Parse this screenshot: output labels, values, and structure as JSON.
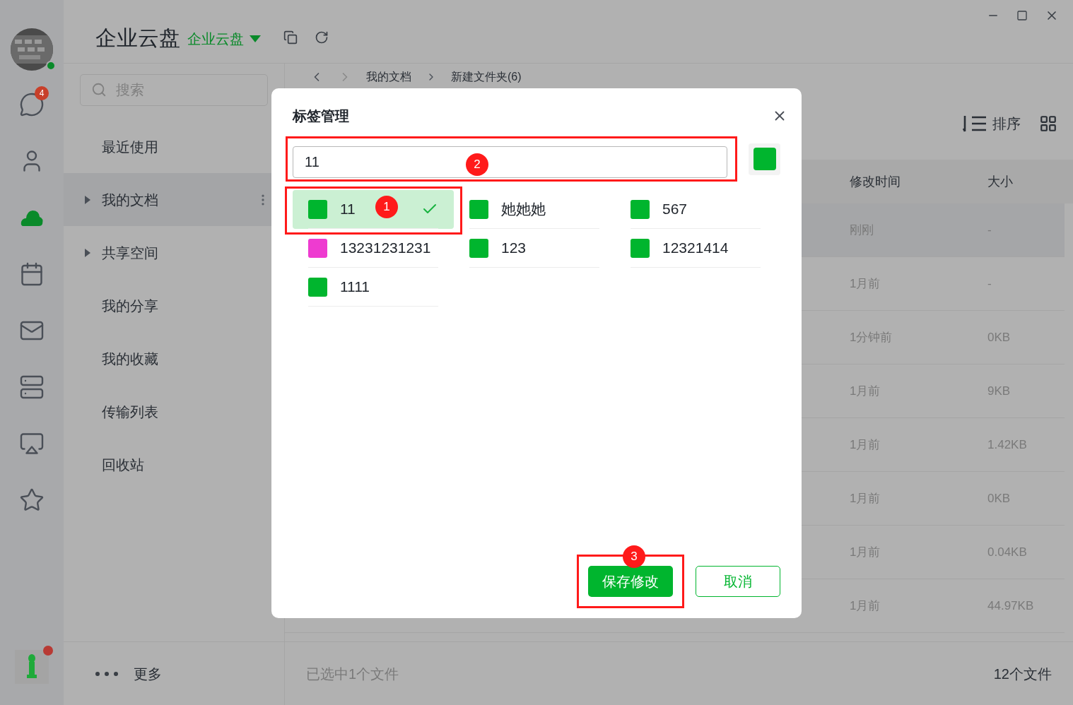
{
  "app": {
    "title": "企业云盘",
    "space": "企业云盘"
  },
  "rail": [
    {
      "kind": "chat",
      "badge": "4",
      "selected": false
    },
    {
      "kind": "contacts",
      "selected": false
    },
    {
      "kind": "cloud",
      "selected": true
    },
    {
      "kind": "calendar",
      "selected": false
    },
    {
      "kind": "mail",
      "selected": false
    },
    {
      "kind": "server",
      "selected": false
    },
    {
      "kind": "screen",
      "selected": false
    },
    {
      "kind": "favorite",
      "selected": false
    }
  ],
  "sidebar": {
    "search": {
      "placeholder": "搜索"
    },
    "items": [
      {
        "label": "最近使用",
        "expandable": false,
        "selected": false
      },
      {
        "label": "我的文档",
        "expandable": true,
        "selected": true
      },
      {
        "label": "共享空间",
        "expandable": true,
        "selected": false
      },
      {
        "label": "我的分享",
        "expandable": false,
        "selected": false
      },
      {
        "label": "我的收藏",
        "expandable": false,
        "selected": false
      },
      {
        "label": "传输列表",
        "expandable": false,
        "selected": false
      },
      {
        "label": "回收站",
        "expandable": false,
        "selected": false
      }
    ],
    "more": "更多"
  },
  "breadcrumb": [
    "我的文档",
    "新建文件夹(6)"
  ],
  "toolbar": {
    "sort": "排序"
  },
  "table": {
    "columns": [
      "修改时间",
      "大小"
    ],
    "rows": [
      {
        "cells": [
          "刚刚",
          "-"
        ],
        "selected": true
      },
      {
        "cells": [
          "1月前",
          "-"
        ],
        "selected": false
      },
      {
        "cells": [
          "1分钟前",
          "0KB"
        ],
        "selected": false
      },
      {
        "cells": [
          "1月前",
          "9KB"
        ],
        "selected": false
      },
      {
        "cells": [
          "1月前",
          "1.42KB"
        ],
        "selected": false
      },
      {
        "cells": [
          "1月前",
          "0KB"
        ],
        "selected": false
      },
      {
        "cells": [
          "1月前",
          "0.04KB"
        ],
        "selected": false
      },
      {
        "cells": [
          "1月前",
          "44.97KB"
        ],
        "selected": false
      }
    ]
  },
  "status_bar": {
    "selection": "已选中1个文件",
    "count": "12个文件"
  },
  "dialog": {
    "title": "标签管理",
    "input": {
      "value": "11"
    },
    "color": "#00b52e",
    "tags": [
      {
        "label": "11",
        "color": "#00b52e",
        "selected": true
      },
      {
        "label": "她她她",
        "color": "#00b52e",
        "selected": false
      },
      {
        "label": "567",
        "color": "#00b52e",
        "selected": false
      },
      {
        "label": "13231231231",
        "color": "#ee3bd0",
        "selected": false
      },
      {
        "label": "123",
        "color": "#00b52e",
        "selected": false
      },
      {
        "label": "12321414",
        "color": "#00b52e",
        "selected": false
      },
      {
        "label": "1111",
        "color": "#00b52e",
        "selected": false
      }
    ],
    "buttons": [
      {
        "label": "保存修改",
        "kind": "primary"
      },
      {
        "label": "取消",
        "kind": "secondary"
      }
    ]
  },
  "annotations": [
    "1",
    "2",
    "3"
  ]
}
